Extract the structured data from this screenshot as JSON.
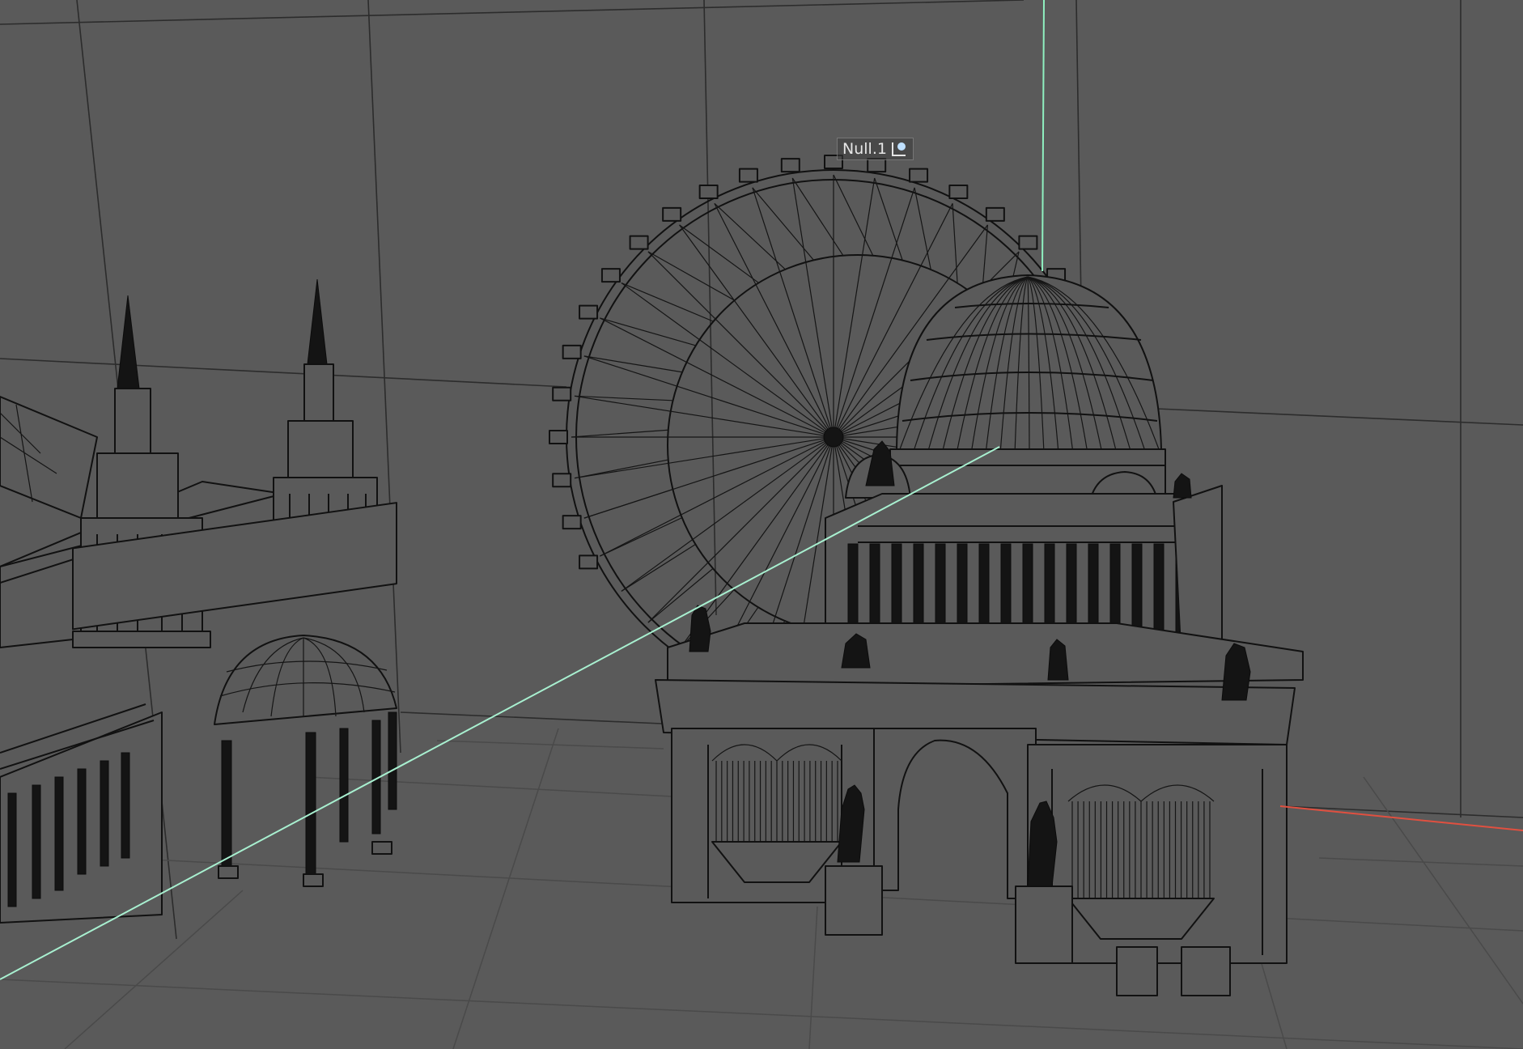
{
  "viewport": {
    "object_label": "Null.1",
    "object_icon": "null-object-icon",
    "colors": {
      "background": "#5a5a5a",
      "axis_y": "#8ff0c0",
      "axis_x": "#e05040",
      "axis_z": "#a8f0d0",
      "wireframe": "#111111",
      "grid": "#2c2c2c"
    }
  }
}
